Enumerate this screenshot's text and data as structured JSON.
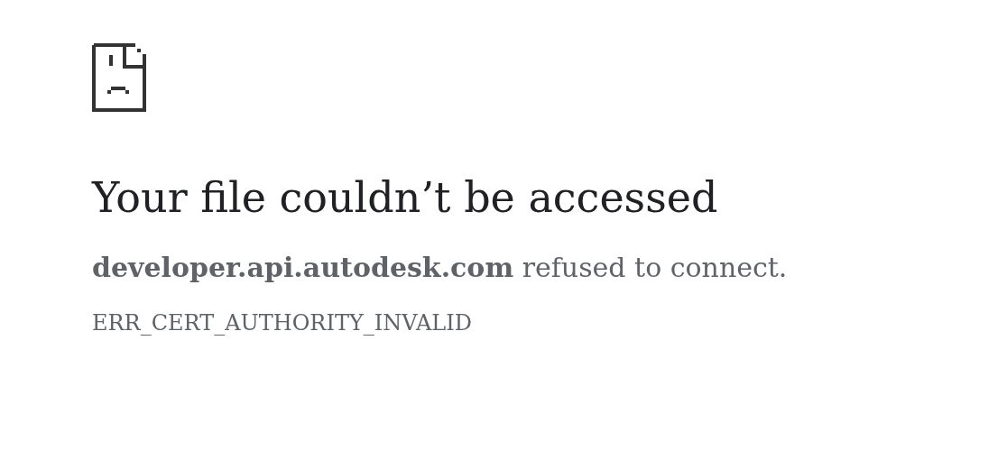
{
  "heading": "Your file couldn’t be accessed",
  "message": "**developer.api.autodesk.com** refused to connect.",
  "error_code": "ERR_CERT_AUTHORITY_INVALID"
}
